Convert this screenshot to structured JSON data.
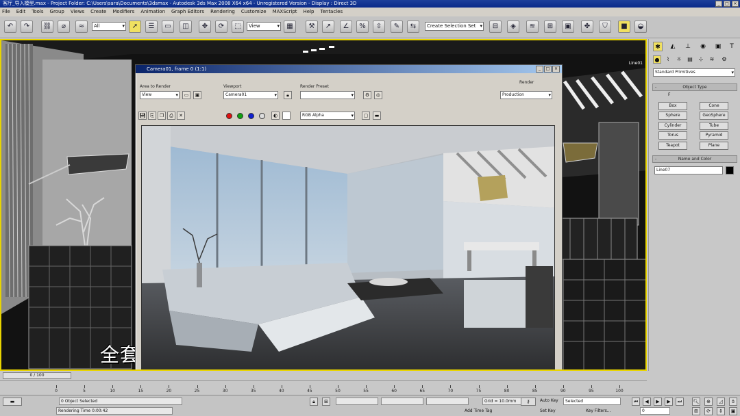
{
  "window": {
    "title": "客厅_导入模型.max   -  Project Folder: C:\\Users\\sara\\Documents\\3dsmax   -   Autodesk 3ds Max  2008 X64 x64  -  Unregistered Version   -   Display : Direct 3D"
  },
  "menu": [
    "File",
    "Edit",
    "Tools",
    "Group",
    "Views",
    "Create",
    "Modifiers",
    "Animation",
    "Graph Editors",
    "Rendering",
    "Customize",
    "MAXScript",
    "Help",
    "Tentacles"
  ],
  "toolbar": {
    "selection_filter": "All",
    "reference_coord": "View",
    "named_selection": "Create Selection Set"
  },
  "viewport": {
    "label": "Line01",
    "subtitle": "全套完整高清视频下载地址：WWW.SNWHY.COM"
  },
  "render_window": {
    "title": "Camera01, frame 0 (1:1)",
    "area_to_render_label": "Area to Render",
    "area_to_render_value": "View",
    "viewport_label": "Viewport",
    "viewport_value": "Camera01",
    "render_preset_label": "Render Preset",
    "render_preset_value": "",
    "render_label": "Render",
    "render_value": "Production",
    "channel_value": "RGB Alpha"
  },
  "command_panel": {
    "category": "Standard Primitives",
    "object_type_header": "Object Type",
    "autogrid": "F",
    "buttons": [
      "Box",
      "Cone",
      "Sphere",
      "GeoSphere",
      "Cylinder",
      "Tube",
      "Torus",
      "Pyramid",
      "Teapot",
      "Plane"
    ],
    "name_color_header": "Name and Color",
    "object_name": "Line07",
    "swatch_color": "#000000"
  },
  "timeline": {
    "frame_display": "0 / 100",
    "ticks": [
      "0",
      "5",
      "10",
      "15",
      "20",
      "25",
      "30",
      "35",
      "40",
      "45",
      "50",
      "55",
      "60",
      "65",
      "70",
      "75",
      "80",
      "85",
      "90",
      "95",
      "100"
    ]
  },
  "status": {
    "selection": "0 Object Selected",
    "render_time": "Rendering Time  0:00:42",
    "grid": "Grid = 10.0mm",
    "auto_key": "Auto Key",
    "set_key": "Set Key",
    "selected_dropdown": "Selected",
    "key_filters": "Key Filters...",
    "add_time_tag": "Add Time Tag",
    "frame": "0"
  }
}
